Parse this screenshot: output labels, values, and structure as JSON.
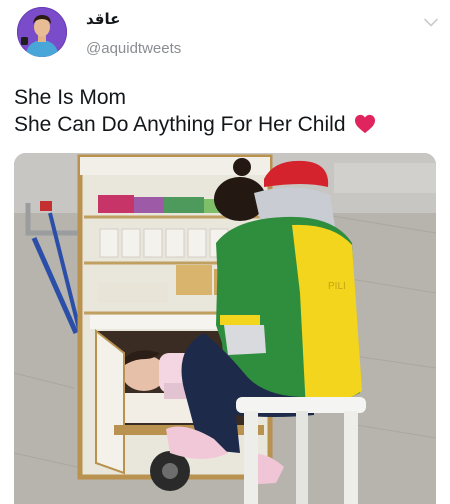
{
  "tweet": {
    "display_name": "عاقد",
    "handle": "@aquidtweets",
    "text_lines": [
      "She Is Mom",
      "She Can Do Anything For Her Child"
    ],
    "photo_alt": ""
  },
  "icons": {
    "avatar": "avatar",
    "menu": "chevron-down-icon",
    "emoji": "red-heart-icon"
  },
  "colors": {
    "text": "#14171a",
    "secondary": "#8a8d91",
    "heart": "#e0245e",
    "avatar_bg": "#6a3db8"
  }
}
